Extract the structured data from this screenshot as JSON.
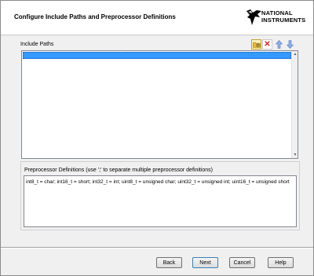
{
  "header": {
    "title": "Configure Include Paths and Preprocessor Definitions",
    "logo": {
      "line1": "NATIONAL",
      "line2": "INSTRUMENTS",
      "icon": "national-instruments-eagle-logo"
    }
  },
  "include_paths": {
    "label": "Include Paths",
    "toolbar": {
      "browse_icon": "browse-folder-icon",
      "delete_icon": "delete-x-icon",
      "move_up_icon": "arrow-up-icon",
      "move_down_icon": "arrow-down-icon"
    },
    "items": [
      ""
    ]
  },
  "preprocessor": {
    "label": "Preprocessor Definitions (use ';' to separate multiple preprocessor definitions)",
    "value": "int8_t = char; int16_t = short; int32_t = int; uint8_t = unsigned char; uint32_t = unsigned int; uint16_t = unsigned short"
  },
  "buttons": {
    "back": "Back",
    "next": "Next",
    "cancel": "Cancel",
    "help": "Help"
  },
  "colors": {
    "selection": "#3399ff",
    "logo_accent": "#000000",
    "delete_red": "#d82020",
    "arrow_blue": "#6b8fcf"
  }
}
